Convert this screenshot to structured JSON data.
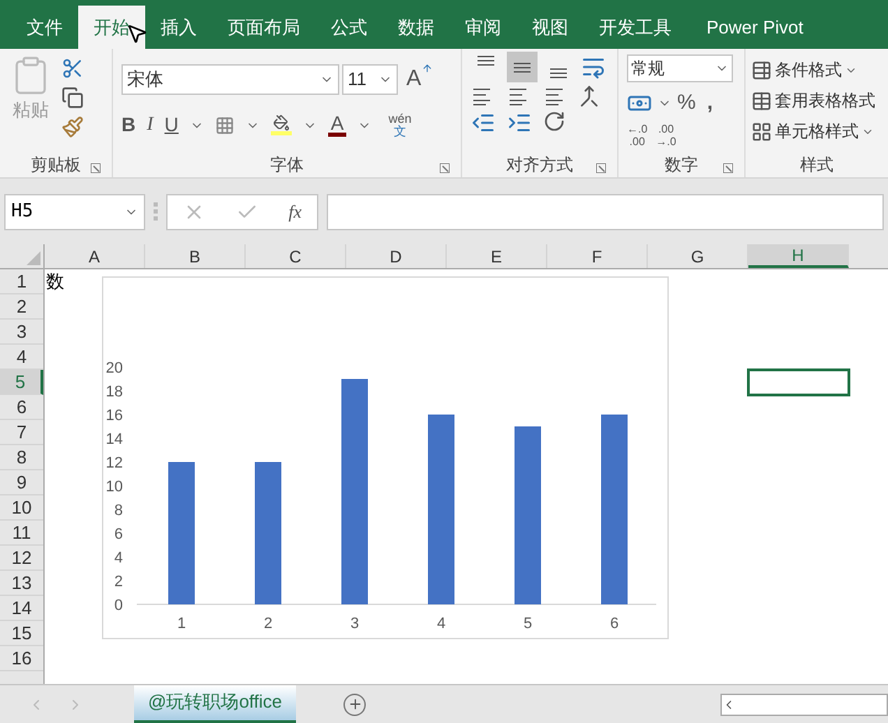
{
  "ribbon_tabs": [
    {
      "label": "文件",
      "selected": false
    },
    {
      "label": "开始",
      "selected": true
    },
    {
      "label": "插入",
      "selected": false
    },
    {
      "label": "页面布局",
      "selected": false
    },
    {
      "label": "公式",
      "selected": false
    },
    {
      "label": "数据",
      "selected": false
    },
    {
      "label": "审阅",
      "selected": false
    },
    {
      "label": "视图",
      "selected": false
    },
    {
      "label": "开发工具",
      "selected": false
    },
    {
      "label": "Power Pivot",
      "selected": false
    }
  ],
  "clipboard": {
    "paste": "粘贴",
    "label": "剪贴板"
  },
  "font": {
    "name": "宋体",
    "size": "11",
    "bold": "B",
    "italic": "I",
    "underline": "U",
    "grow": "A",
    "font_color": "A",
    "phonetic_top": "wén",
    "phonetic_bottom": "文",
    "label": "字体"
  },
  "alignment": {
    "label": "对齐方式",
    "buttons": [
      {
        "kind": "top",
        "selected": false
      },
      {
        "kind": "middle",
        "selected": true
      },
      {
        "kind": "bottom",
        "selected": false
      }
    ]
  },
  "number": {
    "format": "常规",
    "percent": "%",
    "comma": ",",
    "increase_decimal": [
      "←.0",
      ".00"
    ],
    "decrease_decimal": [
      ".00",
      "→.0"
    ],
    "label": "数字"
  },
  "styles": {
    "items": [
      "条件格式",
      "套用表格格式",
      "单元格样式"
    ],
    "label": "样式"
  },
  "formula_bar": {
    "name_box": "H5",
    "fx": "fx"
  },
  "columns": [
    {
      "label": "A",
      "selected": false
    },
    {
      "label": "B",
      "selected": false
    },
    {
      "label": "C",
      "selected": false
    },
    {
      "label": "D",
      "selected": false
    },
    {
      "label": "E",
      "selected": false
    },
    {
      "label": "F",
      "selected": false
    },
    {
      "label": "G",
      "selected": false
    },
    {
      "label": "H",
      "selected": true
    }
  ],
  "rows": [
    {
      "label": "1",
      "selected": false
    },
    {
      "label": "2",
      "selected": false
    },
    {
      "label": "3",
      "selected": false
    },
    {
      "label": "4",
      "selected": false
    },
    {
      "label": "5",
      "selected": true
    },
    {
      "label": "6",
      "selected": false
    },
    {
      "label": "7",
      "selected": false
    },
    {
      "label": "8",
      "selected": false
    },
    {
      "label": "9",
      "selected": false
    },
    {
      "label": "10",
      "selected": false
    },
    {
      "label": "11",
      "selected": false
    },
    {
      "label": "12",
      "selected": false
    },
    {
      "label": "13",
      "selected": false
    },
    {
      "label": "14",
      "selected": false
    },
    {
      "label": "15",
      "selected": false
    },
    {
      "label": "16",
      "selected": false
    }
  ],
  "a1_text": "数",
  "chart_data": {
    "type": "bar",
    "categories": [
      "1",
      "2",
      "3",
      "4",
      "5",
      "6"
    ],
    "series": [
      {
        "color": "#4472c4",
        "values": [
          12,
          12,
          19,
          16,
          15,
          16
        ]
      }
    ],
    "ylim": [
      0,
      20
    ],
    "yticks": [
      0,
      2,
      4,
      6,
      8,
      10,
      12,
      14,
      16,
      18,
      20
    ]
  },
  "sheet_tabs": [
    {
      "label": "@玩转职场office",
      "selected": true
    }
  ]
}
